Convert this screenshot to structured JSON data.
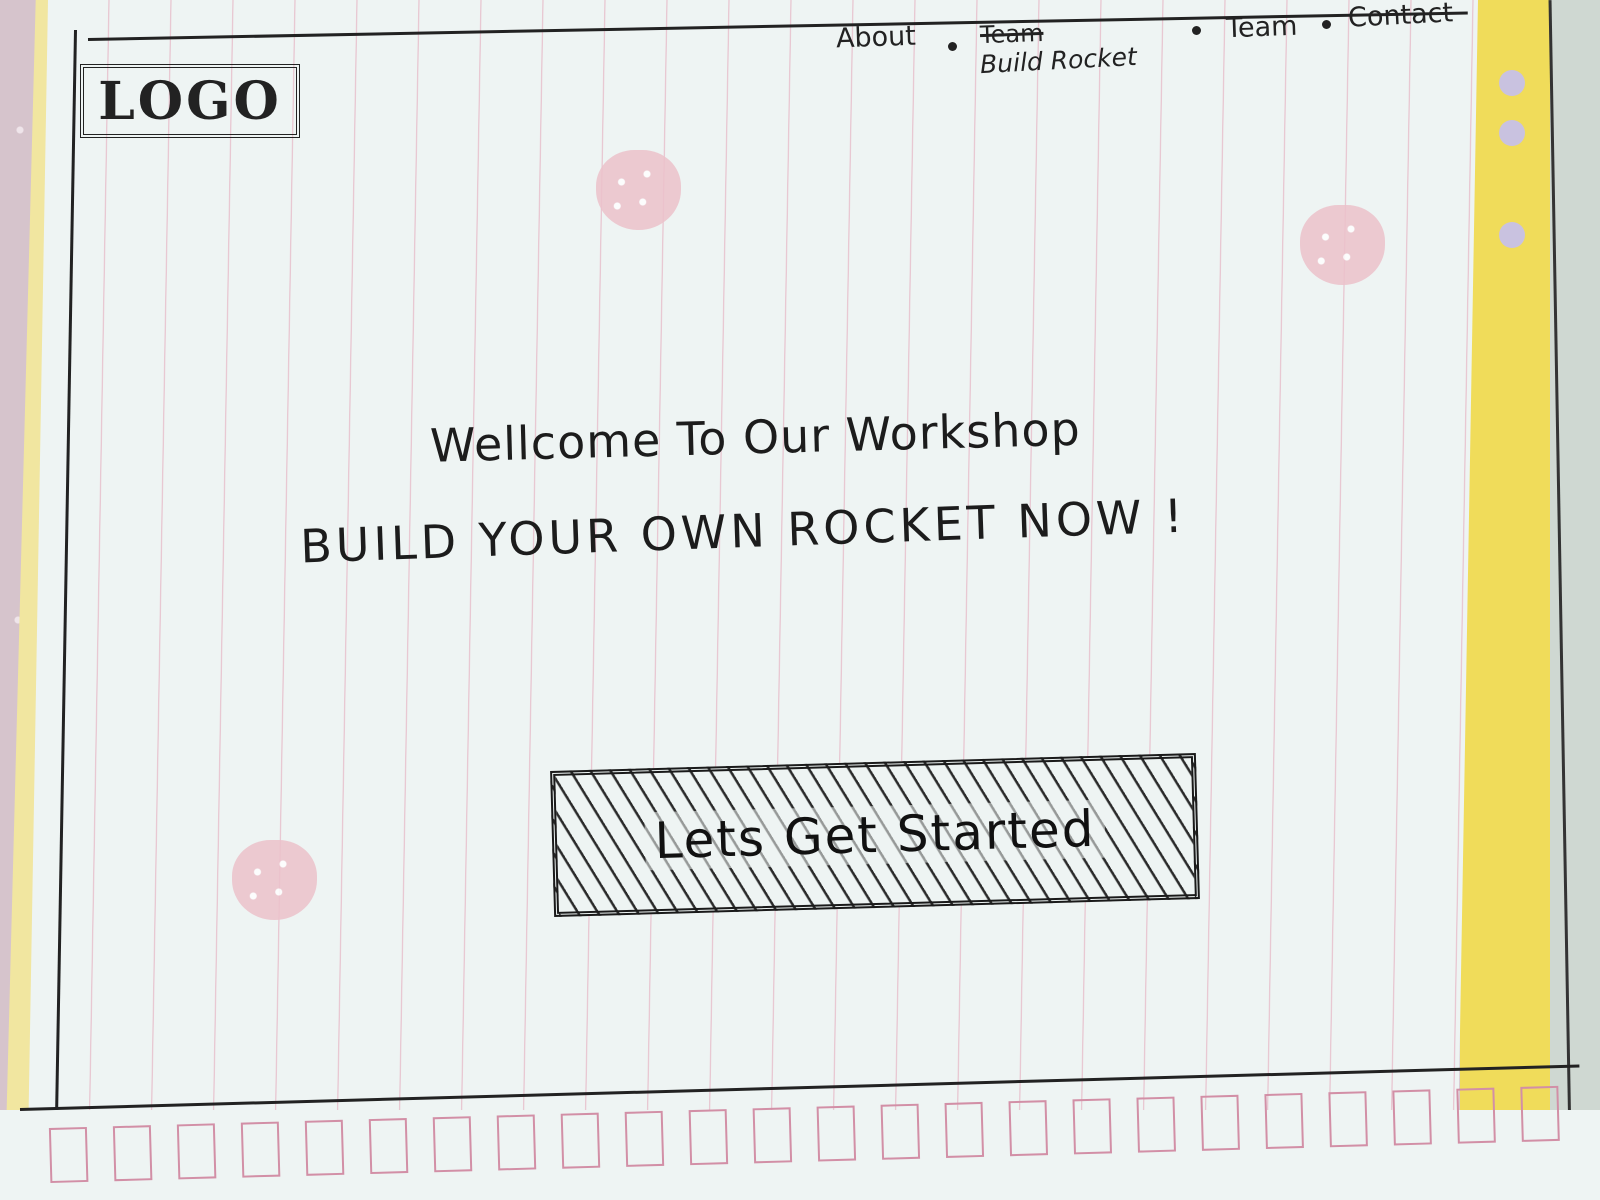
{
  "header": {
    "logo_text": "LOGO",
    "nav": {
      "about": "About",
      "team_crossed": "Team",
      "build_rocket": "Build Rocket",
      "team": "Team",
      "contact": "Contact"
    }
  },
  "hero": {
    "headline": "Wellcome To Our Workshop",
    "subheadline": "BUILD YOUR OWN ROCKET NOW !",
    "cta_label": "Lets Get Started"
  },
  "colors": {
    "ink": "#1c1c1c",
    "paper": "#eef4f3",
    "margin_line": "#e6b9c7",
    "folder_yellow": "#f0dc5a"
  }
}
